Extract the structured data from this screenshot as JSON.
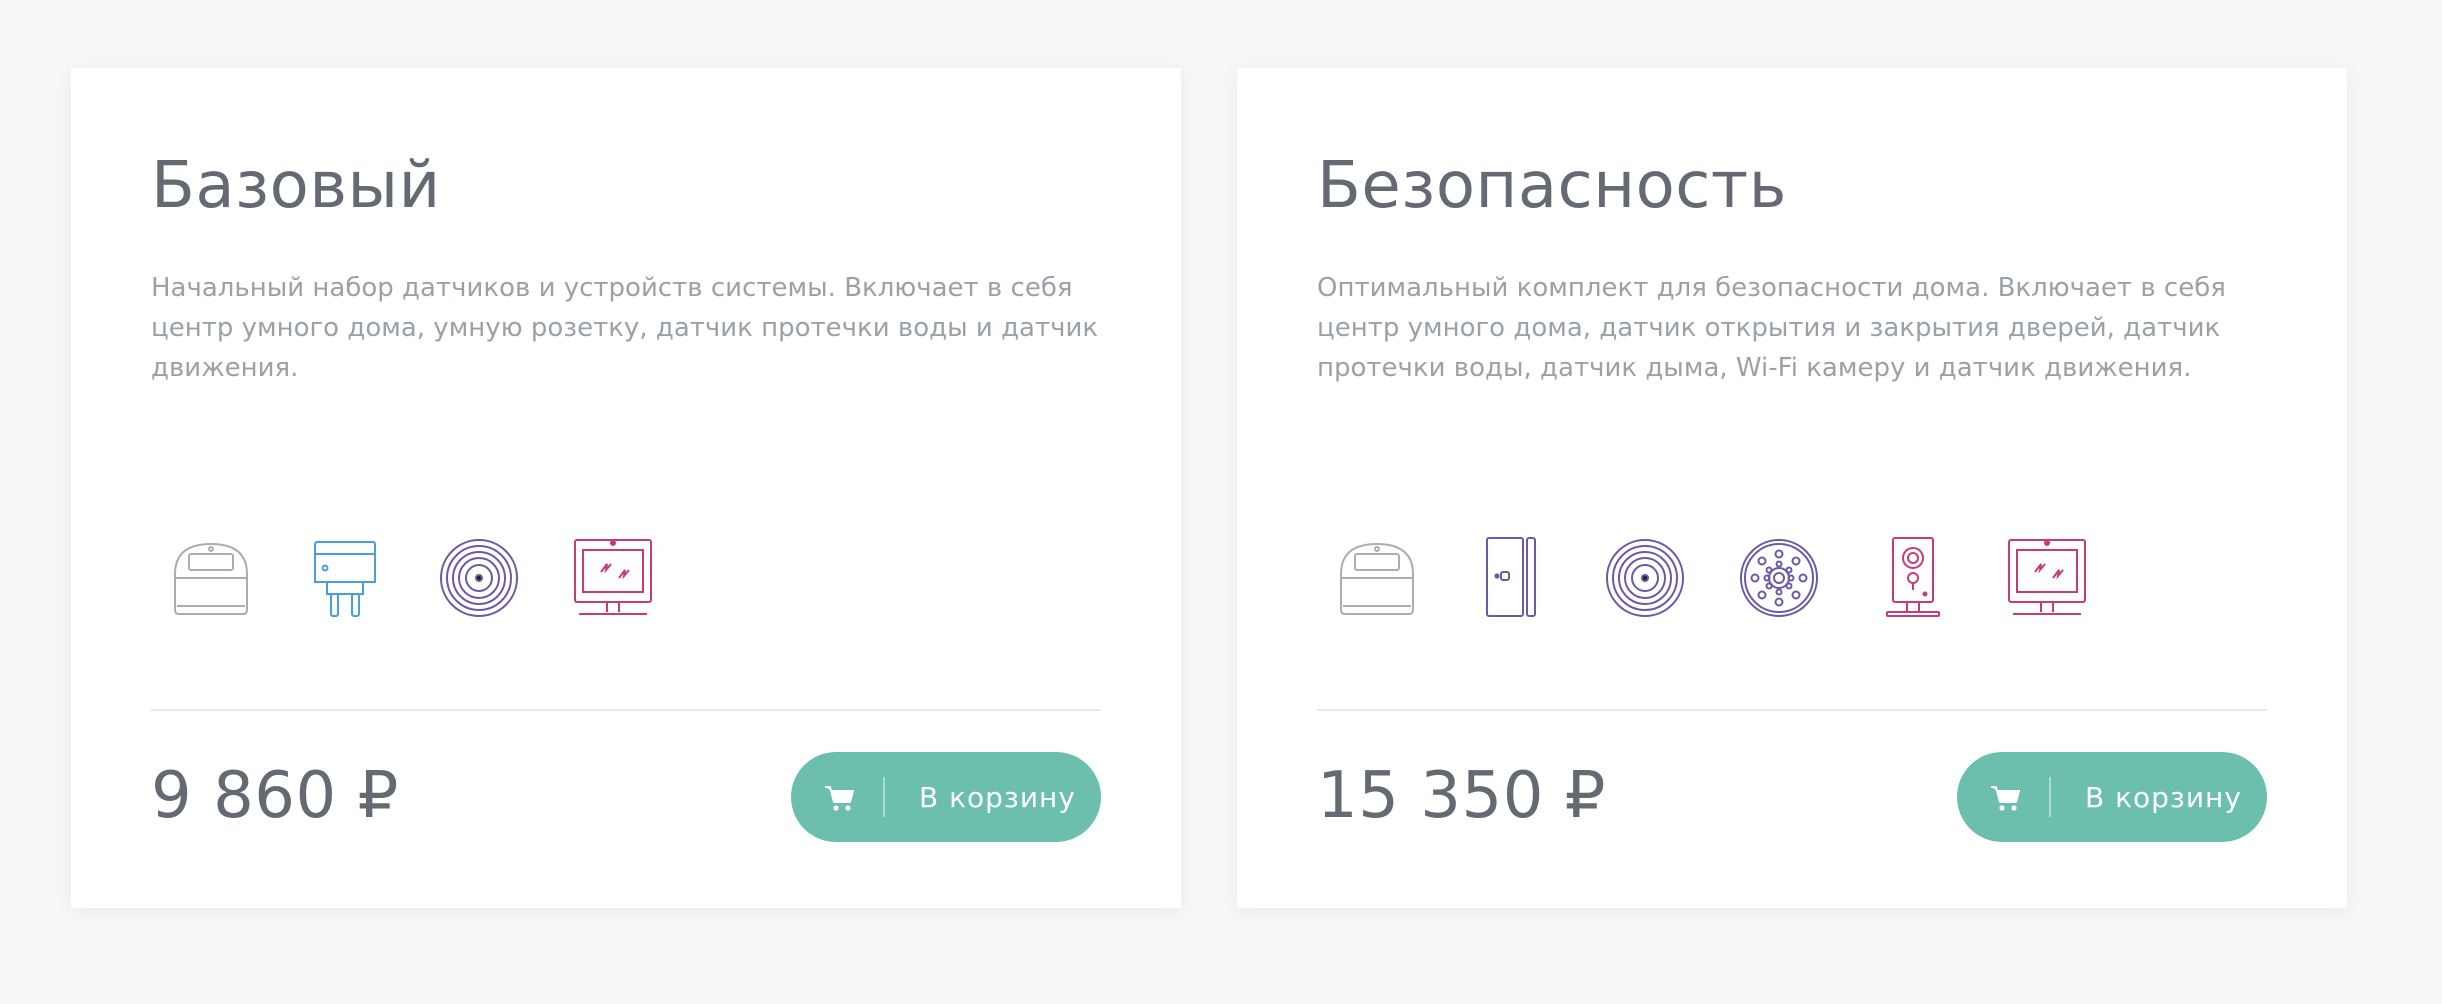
{
  "colors": {
    "page_background": "#f7f7f7",
    "card_background": "#ffffff",
    "title_text": "#636a72",
    "description_text": "#9aa1a8",
    "button_accent": "#6cbfad",
    "icon_gray": "#a9aeb3",
    "icon_blue": "#4a9fd6",
    "icon_purple": "#6a5aa8",
    "icon_pink": "#c83a78"
  },
  "cards": [
    {
      "title": "Базовый",
      "description": "Начальный набор датчиков и устройств системы. Включает в себя центр умного дома, умную розетку, датчик протечки воды и датчик движения.",
      "icons": [
        "hub-icon",
        "smart-plug-icon",
        "water-leak-sensor-icon",
        "motion-sensor-icon"
      ],
      "price": "9 860 ₽",
      "button_label": "В корзину"
    },
    {
      "title": "Безопасность",
      "description": "Оптимальный комплект для безопасности дома. Включает в себя центр умного дома, датчик открытия и закрытия дверей, датчик протечки воды, датчик дыма, Wi-Fi камеру и датчик движения.",
      "icons": [
        "hub-icon",
        "door-sensor-icon",
        "water-leak-sensor-icon",
        "smoke-sensor-icon",
        "wifi-camera-icon",
        "motion-sensor-icon"
      ],
      "price": "15 350 ₽",
      "button_label": "В корзину"
    }
  ]
}
